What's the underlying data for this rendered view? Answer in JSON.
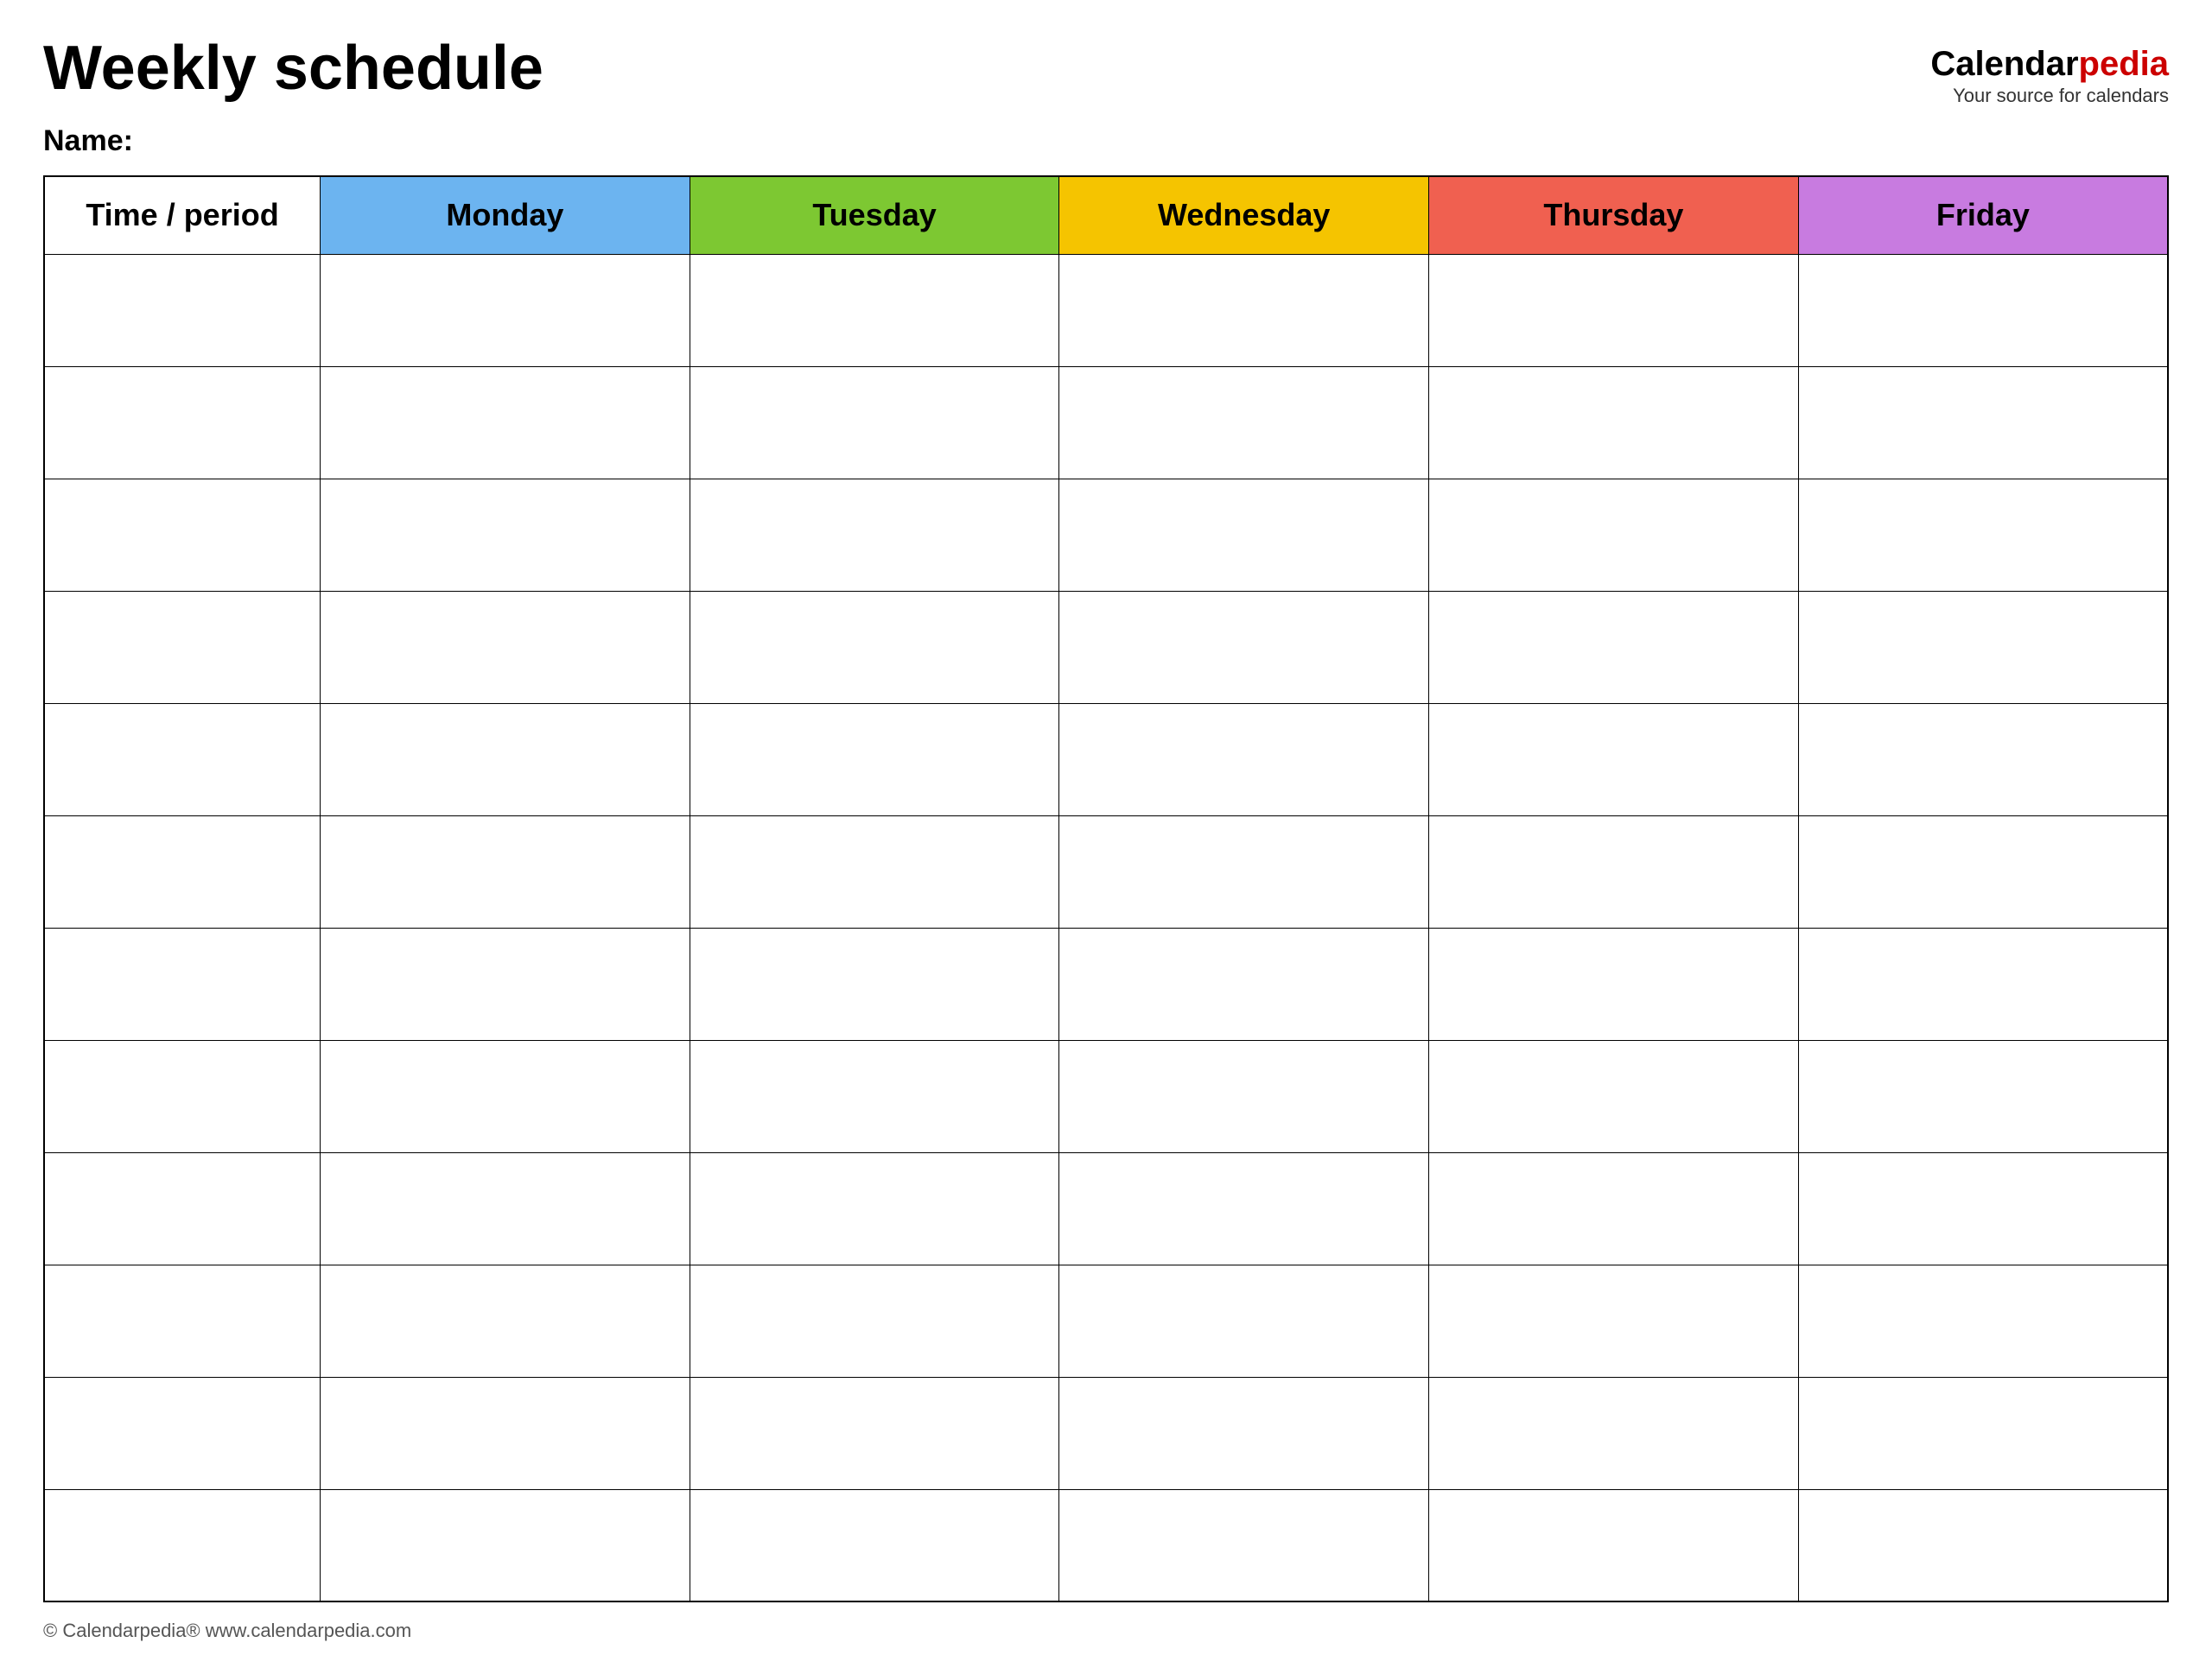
{
  "header": {
    "title": "Weekly schedule",
    "brand": {
      "calendar_part": "Calendar",
      "pedia_part": "pedia",
      "tagline": "Your source for calendars"
    }
  },
  "name_label": "Name:",
  "table": {
    "columns": [
      {
        "key": "time",
        "label": "Time / period",
        "color_class": "col-time"
      },
      {
        "key": "monday",
        "label": "Monday",
        "color_class": "col-monday"
      },
      {
        "key": "tuesday",
        "label": "Tuesday",
        "color_class": "col-tuesday"
      },
      {
        "key": "wednesday",
        "label": "Wednesday",
        "color_class": "col-wednesday"
      },
      {
        "key": "thursday",
        "label": "Thursday",
        "color_class": "col-thursday"
      },
      {
        "key": "friday",
        "label": "Friday",
        "color_class": "col-friday"
      }
    ],
    "row_count": 12
  },
  "footer": {
    "text": "© Calendarpedia®  www.calendarpedia.com"
  }
}
